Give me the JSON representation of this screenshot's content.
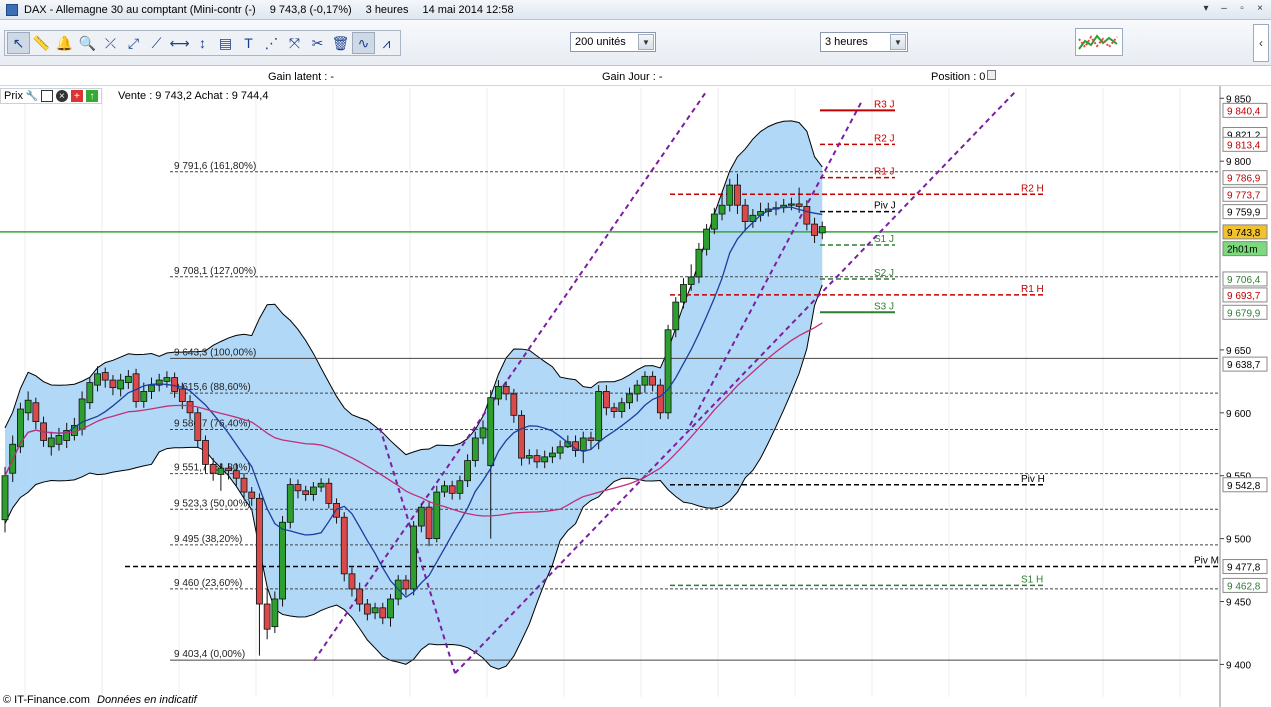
{
  "titlebar": {
    "instrument": "DAX - Allemagne 30 au comptant (Mini-contr (-)",
    "price": "9 743,8 (-0,17%)",
    "period": "3 heures",
    "datetime": "14 mai 2014 12:58"
  },
  "window_buttons": [
    "▾",
    "–",
    "▫",
    "×"
  ],
  "toolbar": {
    "tool_icons": [
      "cursor-icon",
      "ruler-icon",
      "alarm-bell-icon",
      "zoom-icon",
      "fibonacci-icon",
      "trendline-icon",
      "ray-icon",
      "horizontal-line-icon",
      "vertical-line-icon",
      "indicator-icon",
      "text-icon",
      "channel-icon",
      "pitchfork-icon",
      "tools-icon",
      "trash-icon",
      "line-style-icon",
      "pattern-icon"
    ],
    "units_select": "200 unités",
    "period_select": "3 heures"
  },
  "infobar": {
    "gain_latent": "Gain latent : -",
    "gain_jour": "Gain Jour : -",
    "position": "Position : 0"
  },
  "prix_panel": {
    "label": "Prix",
    "quote": "Vente : 9 743,2 Achat : 9 744,4"
  },
  "footer": {
    "brand": "© IT-Finance.com",
    "note": "Données en indicatif"
  },
  "colors": {
    "bull": "#2e9f2e",
    "bear": "#d94a4a",
    "band_fill": "#a9d4f5",
    "sma_blue": "#1d3e9e",
    "sma_magenta": "#c0307a",
    "channel": "#7b1fa2",
    "current_price": "#3aa33a",
    "price_tag": "#f2c12e"
  },
  "chart_data": {
    "type": "candlestick",
    "y_axis": {
      "min": 9390,
      "max": 9855,
      "ticks": [
        "9 850",
        "9 800",
        "9 650",
        "9 600",
        "9 550",
        "9 500",
        "9 450",
        "9 400"
      ],
      "tick_values": [
        9850,
        9800,
        9650,
        9600,
        9550,
        9500,
        9450,
        9400
      ]
    },
    "price_tags": [
      {
        "value": 9840.4,
        "label": "9 840,4",
        "color": "#c00000"
      },
      {
        "value": 9821.2,
        "label": "9 821,2",
        "color": "#000000"
      },
      {
        "value": 9813.4,
        "label": "9 813,4",
        "color": "#c00000"
      },
      {
        "value": 9786.9,
        "label": "9 786,9",
        "color": "#c00000"
      },
      {
        "value": 9773.7,
        "label": "9 773,7",
        "color": "#c00000"
      },
      {
        "value": 9759.9,
        "label": "9 759,9",
        "color": "#000000"
      },
      {
        "value": 9743.8,
        "label": "9 743,8",
        "color": "#000000",
        "current": true
      },
      {
        "value": 9730.5,
        "label": "2h01m",
        "color": "#000000",
        "timer": true
      },
      {
        "value": 9706.4,
        "label": "9 706,4",
        "color": "#2e7d32"
      },
      {
        "value": 9693.7,
        "label": "9 693,7",
        "color": "#c00000"
      },
      {
        "value": 9679.9,
        "label": "9 679,9",
        "color": "#2e7d32"
      },
      {
        "value": 9638.7,
        "label": "9 638,7",
        "color": "#000000"
      },
      {
        "value": 9542.8,
        "label": "9 542,8",
        "color": "#000000"
      },
      {
        "value": 9477.8,
        "label": "9 477,8",
        "color": "#000000"
      },
      {
        "value": 9462.8,
        "label": "9 462,8",
        "color": "#2e7d32"
      }
    ],
    "fibonacci": [
      {
        "value": 9791.6,
        "label": "9 791,6 (161,80%)"
      },
      {
        "value": 9708.1,
        "label": "9 708,1 (127,00%)"
      },
      {
        "value": 9643.3,
        "label": "9 643,3 (100,00%)",
        "solid": true
      },
      {
        "value": 9615.6,
        "label": "9 615,6 (88,60%)"
      },
      {
        "value": 9586.7,
        "label": "9 586,7 (76,40%)"
      },
      {
        "value": 9551.7,
        "label": "9 551,7 (61,80%)"
      },
      {
        "value": 9523.3,
        "label": "9 523,3 (50,00%)"
      },
      {
        "value": 9495,
        "label": "9 495 (38,20%)"
      },
      {
        "value": 9460,
        "label": "9 460 (23,60%)"
      },
      {
        "value": 9403.4,
        "label": "9 403,4 (0,00%)",
        "solid": true
      }
    ],
    "pivots": [
      {
        "label": "R3 J",
        "value": 9840.4,
        "style": "solid",
        "color": "#c00000",
        "span": "day"
      },
      {
        "label": "R2 J",
        "value": 9813.4,
        "style": "dashed",
        "color": "#c00000",
        "span": "day"
      },
      {
        "label": "R1 J",
        "value": 9786.9,
        "style": "dashed",
        "color": "#c00000",
        "span": "day"
      },
      {
        "label": "Piv J",
        "value": 9759.9,
        "style": "dashed",
        "color": "#000000",
        "span": "day"
      },
      {
        "label": "S1 J",
        "value": 9733.4,
        "style": "dashed",
        "color": "#2e7d32",
        "span": "day"
      },
      {
        "label": "S2 J",
        "value": 9706.4,
        "style": "dashed",
        "color": "#2e7d32",
        "span": "day"
      },
      {
        "label": "S3 J",
        "value": 9679.9,
        "style": "solid",
        "color": "#2e7d32",
        "span": "day"
      },
      {
        "label": "R2 H",
        "value": 9773.7,
        "style": "dashed",
        "color": "#c00000",
        "span": "week"
      },
      {
        "label": "R1 H",
        "value": 9693.7,
        "style": "dashed",
        "color": "#c00000",
        "span": "week"
      },
      {
        "label": "Piv H",
        "value": 9542.8,
        "style": "dashed",
        "color": "#000000",
        "span": "week"
      },
      {
        "label": "S1 H",
        "value": 9462.8,
        "style": "dashed",
        "color": "#2e7d32",
        "span": "week"
      },
      {
        "label": "Piv M",
        "value": 9477.8,
        "style": "dashed",
        "color": "#000000",
        "span": "month"
      }
    ],
    "current_price": 9743.8,
    "candles": [
      [
        9550,
        9515,
        9557,
        9505
      ],
      [
        9575,
        9552,
        9582,
        9545
      ],
      [
        9603,
        9573,
        9608,
        9568
      ],
      [
        9610,
        9600,
        9617,
        9594
      ],
      [
        9593,
        9608,
        9612,
        9587
      ],
      [
        9578,
        9592,
        9597,
        9573
      ],
      [
        9580,
        9573,
        9585,
        9566
      ],
      [
        9582,
        9575,
        9588,
        9570
      ],
      [
        9586,
        9578,
        9592,
        9572
      ],
      [
        9590,
        9582,
        9596,
        9578
      ],
      [
        9611,
        9587,
        9617,
        9582
      ],
      [
        9624,
        9608,
        9628,
        9603
      ],
      [
        9631,
        9622,
        9637,
        9617
      ],
      [
        9626,
        9632,
        9636,
        9620
      ],
      [
        9620,
        9626,
        9630,
        9614
      ],
      [
        9626,
        9619,
        9631,
        9613
      ],
      [
        9629,
        9624,
        9634,
        9619
      ],
      [
        9609,
        9631,
        9635,
        9604
      ],
      [
        9617,
        9609,
        9624,
        9604
      ],
      [
        9622,
        9617,
        9628,
        9611
      ],
      [
        9626,
        9622,
        9631,
        9617
      ],
      [
        9628,
        9625,
        9633,
        9620
      ],
      [
        9617,
        9628,
        9632,
        9612
      ],
      [
        9609,
        9619,
        9624,
        9603
      ],
      [
        9600,
        9609,
        9614,
        9595
      ],
      [
        9578,
        9600,
        9604,
        9572
      ],
      [
        9559,
        9578,
        9582,
        9552
      ],
      [
        9552,
        9559,
        9564,
        9546
      ],
      [
        9556,
        9551,
        9560,
        9538
      ],
      [
        9554,
        9556,
        9560,
        9547
      ],
      [
        9548,
        9554,
        9560,
        9542
      ],
      [
        9537,
        9548,
        9552,
        9531
      ],
      [
        9532,
        9537,
        9541,
        9526
      ],
      [
        9448,
        9532,
        9536,
        9407
      ],
      [
        9428,
        9448,
        9460,
        9420
      ],
      [
        9452,
        9430,
        9458,
        9425
      ],
      [
        9513,
        9452,
        9518,
        9446
      ],
      [
        9543,
        9513,
        9548,
        9508
      ],
      [
        9538,
        9543,
        9547,
        9532
      ],
      [
        9535,
        9538,
        9542,
        9530
      ],
      [
        9541,
        9535,
        9545,
        9530
      ],
      [
        9544,
        9541,
        9548,
        9537
      ],
      [
        9528,
        9544,
        9548,
        9524
      ],
      [
        9517,
        9528,
        9532,
        9512
      ],
      [
        9472,
        9517,
        9521,
        9466
      ],
      [
        9460,
        9472,
        9477,
        9454
      ],
      [
        9448,
        9460,
        9465,
        9442
      ],
      [
        9440,
        9448,
        9452,
        9435
      ],
      [
        9445,
        9441,
        9449,
        9436
      ],
      [
        9437,
        9445,
        9449,
        9432
      ],
      [
        9452,
        9437,
        9456,
        9430
      ],
      [
        9467,
        9452,
        9471,
        9447
      ],
      [
        9460,
        9467,
        9471,
        9455
      ],
      [
        9510,
        9460,
        9514,
        9455
      ],
      [
        9525,
        9510,
        9528,
        9505
      ],
      [
        9500,
        9525,
        9530,
        9494
      ],
      [
        9537,
        9500,
        9542,
        9497
      ],
      [
        9542,
        9537,
        9546,
        9533
      ],
      [
        9536,
        9542,
        9546,
        9531
      ],
      [
        9546,
        9536,
        9550,
        9531
      ],
      [
        9562,
        9546,
        9567,
        9541
      ],
      [
        9580,
        9562,
        9585,
        9557
      ],
      [
        9588,
        9580,
        9594,
        9575
      ],
      [
        9612,
        9558,
        9618,
        9500
      ],
      [
        9621,
        9611,
        9626,
        9606
      ],
      [
        9615,
        9621,
        9625,
        9610
      ],
      [
        9598,
        9615,
        9619,
        9592
      ],
      [
        9564,
        9598,
        9602,
        9558
      ],
      [
        9566,
        9564,
        9571,
        9559
      ],
      [
        9561,
        9566,
        9571,
        9556
      ],
      [
        9565,
        9561,
        9570,
        9556
      ],
      [
        9568,
        9565,
        9573,
        9560
      ],
      [
        9573,
        9568,
        9578,
        9563
      ],
      [
        9577,
        9573,
        9582,
        9572
      ],
      [
        9570,
        9577,
        9582,
        9565
      ],
      [
        9580,
        9570,
        9585,
        9560
      ],
      [
        9578,
        9580,
        9585,
        9571
      ],
      [
        9617,
        9578,
        9622,
        9571
      ],
      [
        9604,
        9617,
        9622,
        9598
      ],
      [
        9601,
        9604,
        9608,
        9596
      ],
      [
        9608,
        9601,
        9612,
        9596
      ],
      [
        9615,
        9608,
        9620,
        9603
      ],
      [
        9622,
        9615,
        9626,
        9609
      ],
      [
        9629,
        9622,
        9633,
        9616
      ],
      [
        9622,
        9629,
        9633,
        9617
      ],
      [
        9600,
        9622,
        9627,
        9595
      ],
      [
        9666,
        9600,
        9670,
        9595
      ],
      [
        9688,
        9666,
        9692,
        9660
      ],
      [
        9702,
        9688,
        9707,
        9683
      ],
      [
        9708,
        9702,
        9718,
        9697
      ],
      [
        9730,
        9708,
        9735,
        9703
      ],
      [
        9746,
        9730,
        9750,
        9725
      ],
      [
        9758,
        9746,
        9763,
        9742
      ],
      [
        9765,
        9758,
        9775,
        9753
      ],
      [
        9781,
        9765,
        9786,
        9760
      ],
      [
        9765,
        9781,
        9790,
        9758
      ],
      [
        9752,
        9765,
        9770,
        9745
      ],
      [
        9757,
        9752,
        9762,
        9747
      ],
      [
        9760,
        9757,
        9767,
        9752
      ],
      [
        9762,
        9760,
        9767,
        9756
      ],
      [
        9763,
        9762,
        9768,
        9757
      ],
      [
        9765,
        9763,
        9770,
        9759
      ],
      [
        9766,
        9765,
        9771,
        9761
      ],
      [
        9764,
        9766,
        9779,
        9759
      ],
      [
        9750,
        9764,
        9769,
        9745
      ],
      [
        9741,
        9750,
        9755,
        9735
      ],
      [
        9748,
        9743,
        9752,
        9738
      ]
    ]
  }
}
